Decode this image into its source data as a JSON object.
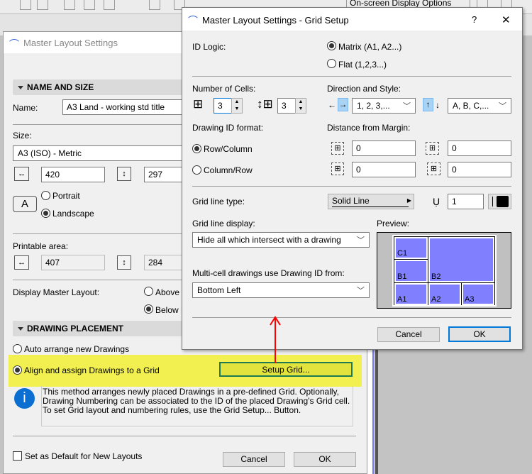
{
  "toolbar": {
    "display_options": "On-screen Display Options"
  },
  "main_dialog": {
    "title": "Master Layout Settings",
    "name_size": {
      "header": "NAME AND SIZE",
      "name_label": "Name:",
      "name_value": "A3 Land - working std title",
      "size_label": "Size:",
      "size_value": "A3 (ISO) - Metric",
      "width": "420",
      "height": "297",
      "portrait": "Portrait",
      "landscape": "Landscape",
      "orientation_selected": "Landscape",
      "printable_label": "Printable area:",
      "printable_width": "407",
      "printable_height": "284",
      "display_label": "Display Master Layout:",
      "above": "Above L",
      "below": "Below L",
      "display_selected": "Below"
    },
    "placement": {
      "header": "DRAWING PLACEMENT",
      "auto": "Auto arrange new Drawings",
      "align": "Align and assign Drawings to a Grid",
      "selected": "Align",
      "setup_button": "Setup Grid...",
      "info": "This method arranges newly placed Drawings in a pre-defined Grid. Optionally, Drawing Numbering can be associated to the ID of the placed Drawing's Grid cell. To set Grid layout and numbering rules, use the Grid Setup... Button."
    },
    "default_checkbox": "Set as Default for New Layouts",
    "default_checked": false,
    "cancel": "Cancel",
    "ok": "OK"
  },
  "grid_dialog": {
    "title": "Master Layout Settings - Grid Setup",
    "help": "?",
    "close": "✕",
    "id_logic_label": "ID Logic:",
    "matrix": "Matrix (A1, A2...)",
    "flat": "Flat (1,2,3...)",
    "id_logic_selected": "Matrix",
    "cells_label": "Number of Cells:",
    "columns": "3",
    "rows": "3",
    "direction_label": "Direction and Style:",
    "col_style": "1, 2, 3,...",
    "row_style": "A, B, C,...",
    "id_format_label": "Drawing ID format:",
    "row_col": "Row/Column",
    "col_row": "Column/Row",
    "id_format_selected": "Row/Column",
    "margin_label": "Distance from Margin:",
    "margin_top": "0",
    "margin_left": "0",
    "margin_bottom": "0",
    "margin_right": "0",
    "line_type_label": "Grid line type:",
    "line_type": "Solid Line",
    "pen": "1",
    "line_display_label": "Grid line display:",
    "line_display": "Hide all which intersect with a drawing",
    "multicell_label": "Multi-cell drawings use Drawing ID from:",
    "multicell": "Bottom Left",
    "preview_label": "Preview:",
    "preview_cells": [
      "C1",
      "B1",
      "B2",
      "A1",
      "A2",
      "A3"
    ],
    "cancel": "Cancel",
    "ok": "OK"
  },
  "colors": {
    "highlight": "#f2f050",
    "accent": "#0078d7",
    "preview_cell": "#8080ff",
    "arrow": "#ff0000"
  }
}
